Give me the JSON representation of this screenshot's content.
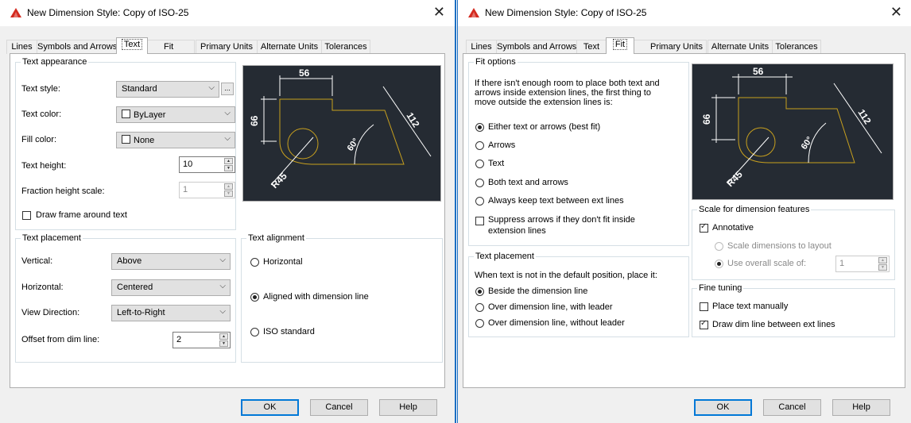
{
  "left": {
    "title": "New Dimension Style: Copy of ISO-25",
    "tabs": [
      "Lines",
      "Symbols and Arrows",
      "Text",
      "Fit",
      "Primary Units",
      "Alternate Units",
      "Tolerances"
    ],
    "active_tab": "Text",
    "text_appearance": {
      "group_label": "Text appearance",
      "text_style_label": "Text style:",
      "text_style_value": "Standard",
      "text_style_button": "...",
      "text_color_label": "Text color:",
      "text_color_value": "ByLayer",
      "fill_color_label": "Fill color:",
      "fill_color_value": "None",
      "text_height_label": "Text height:",
      "text_height_value": "10",
      "fraction_height_label": "Fraction height scale:",
      "fraction_height_value": "1",
      "draw_frame_label": "Draw frame around text",
      "draw_frame_checked": false
    },
    "text_placement": {
      "group_label": "Text placement",
      "vertical_label": "Vertical:",
      "vertical_value": "Above",
      "horizontal_label": "Horizontal:",
      "horizontal_value": "Centered",
      "view_direction_label": "View Direction:",
      "view_direction_value": "Left-to-Right",
      "offset_label": "Offset from dim line:",
      "offset_value": "2"
    },
    "text_alignment": {
      "group_label": "Text alignment",
      "options": [
        "Horizontal",
        "Aligned with dimension line",
        "ISO standard"
      ],
      "selected": "Aligned with dimension line"
    },
    "buttons": {
      "ok": "OK",
      "cancel": "Cancel",
      "help": "Help"
    }
  },
  "right": {
    "title": "New Dimension Style: Copy of ISO-25",
    "tabs": [
      "Lines",
      "Symbols and Arrows",
      "Text",
      "Fit",
      "Primary Units",
      "Alternate Units",
      "Tolerances"
    ],
    "active_tab": "Fit",
    "fit_options": {
      "group_label": "Fit options",
      "description": [
        "If there isn't enough room to place both text and",
        "arrows inside extension lines, the first thing to",
        "move outside the extension lines is:"
      ],
      "options": [
        "Either text or arrows (best fit)",
        "Arrows",
        "Text",
        "Both text and arrows",
        "Always keep text between ext lines"
      ],
      "selected": "Either text or arrows (best fit)",
      "suppress_label_1": "Suppress arrows if they don't fit inside",
      "suppress_label_2": "extension lines",
      "suppress_checked": false
    },
    "text_placement": {
      "group_label": "Text placement",
      "description": "When text is not in the default position, place it:",
      "options": [
        "Beside the dimension line",
        "Over dimension line, with leader",
        "Over dimension line, without leader"
      ],
      "selected": "Beside the dimension line"
    },
    "scale": {
      "group_label": "Scale for dimension features",
      "annotative_label": "Annotative",
      "annotative_checked": true,
      "scale_layout_label": "Scale dimensions to layout",
      "overall_scale_label": "Use overall scale of:",
      "overall_scale_value": "1"
    },
    "fine_tuning": {
      "group_label": "Fine tuning",
      "place_manually_label": "Place text manually",
      "place_manually_checked": false,
      "draw_dim_label": "Draw dim line between ext lines",
      "draw_dim_checked": true
    },
    "buttons": {
      "ok": "OK",
      "cancel": "Cancel",
      "help": "Help"
    }
  },
  "preview": {
    "dim_top": "56",
    "dim_left": "66",
    "dim_diag": "112",
    "dim_angle": "60°",
    "dim_radius": "R45"
  },
  "colors": {
    "preview_bg": "#252b33",
    "geometry": "#c8a01e",
    "dimension": "#ffffff",
    "accent": "#0078d7",
    "title_icon": "#d42a1f"
  }
}
